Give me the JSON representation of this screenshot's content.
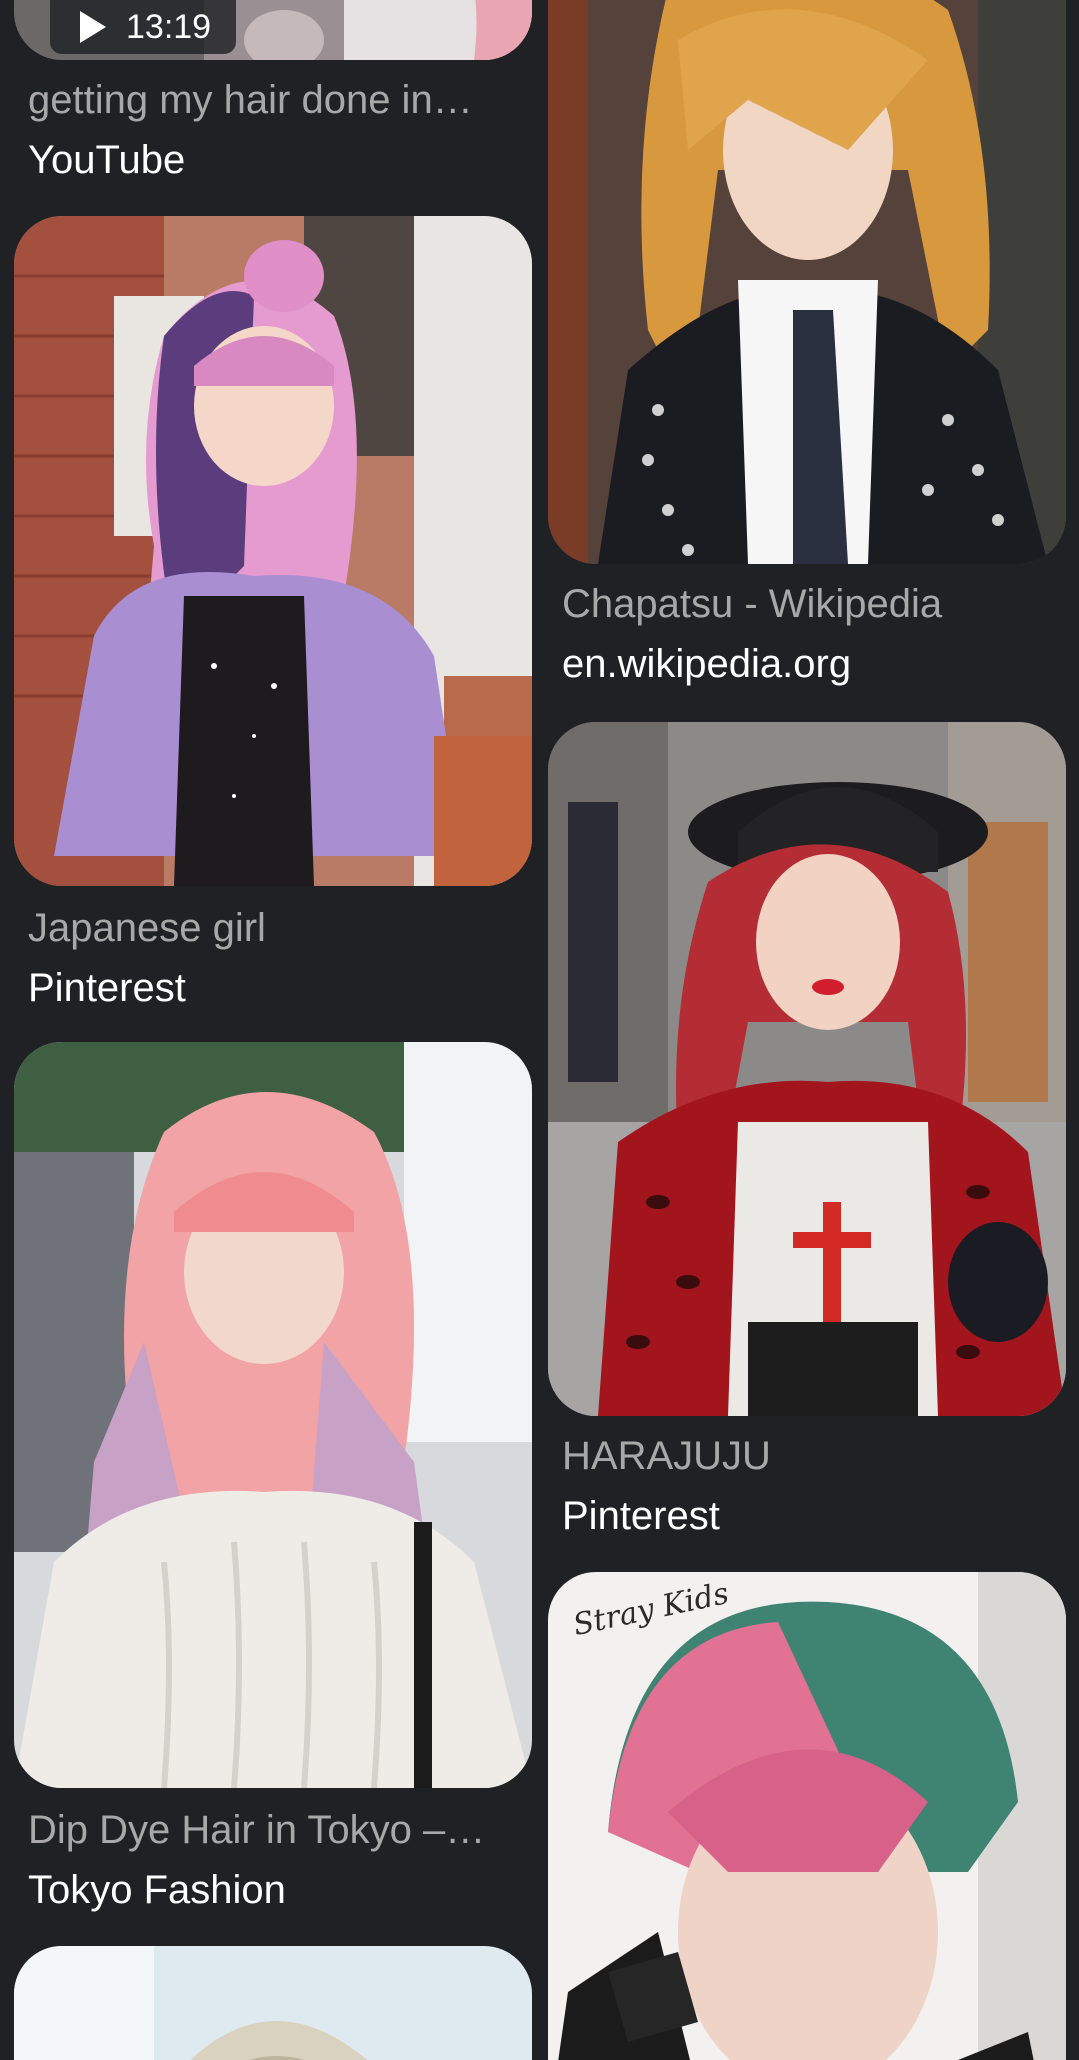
{
  "results": [
    {
      "title": "getting my hair done in…",
      "source": "YouTube",
      "duration": "13:19",
      "image_alt": "person with pink hair (cropped)"
    },
    {
      "title": "Japanese girl",
      "source": "Pinterest",
      "image_alt": "girl with purple and pink hair in lavender coat"
    },
    {
      "title": "Dip Dye Hair in Tokyo –…",
      "source": "Tokyo Fashion",
      "image_alt": "girl with pink to blue dip dyed hair in white sweater"
    },
    {
      "title": "",
      "source": "",
      "image_alt": "person with light blonde hair (cropped)"
    },
    {
      "title": "Chapatsu - Wikipedia",
      "source": "en.wikipedia.org",
      "image_alt": "young man with orange-brown hair, studded jacket"
    },
    {
      "title": "HARAJUJU",
      "source": "Pinterest",
      "image_alt": "girl with red hair wearing black hat and red leopard jacket"
    },
    {
      "title": "",
      "source": "",
      "image_alt": "person with pink and green hair",
      "watermark": "Stray Kids"
    }
  ],
  "colors": {
    "background": "#202124",
    "title_text": "#a8a8a8",
    "source_text": "#ffffff"
  }
}
